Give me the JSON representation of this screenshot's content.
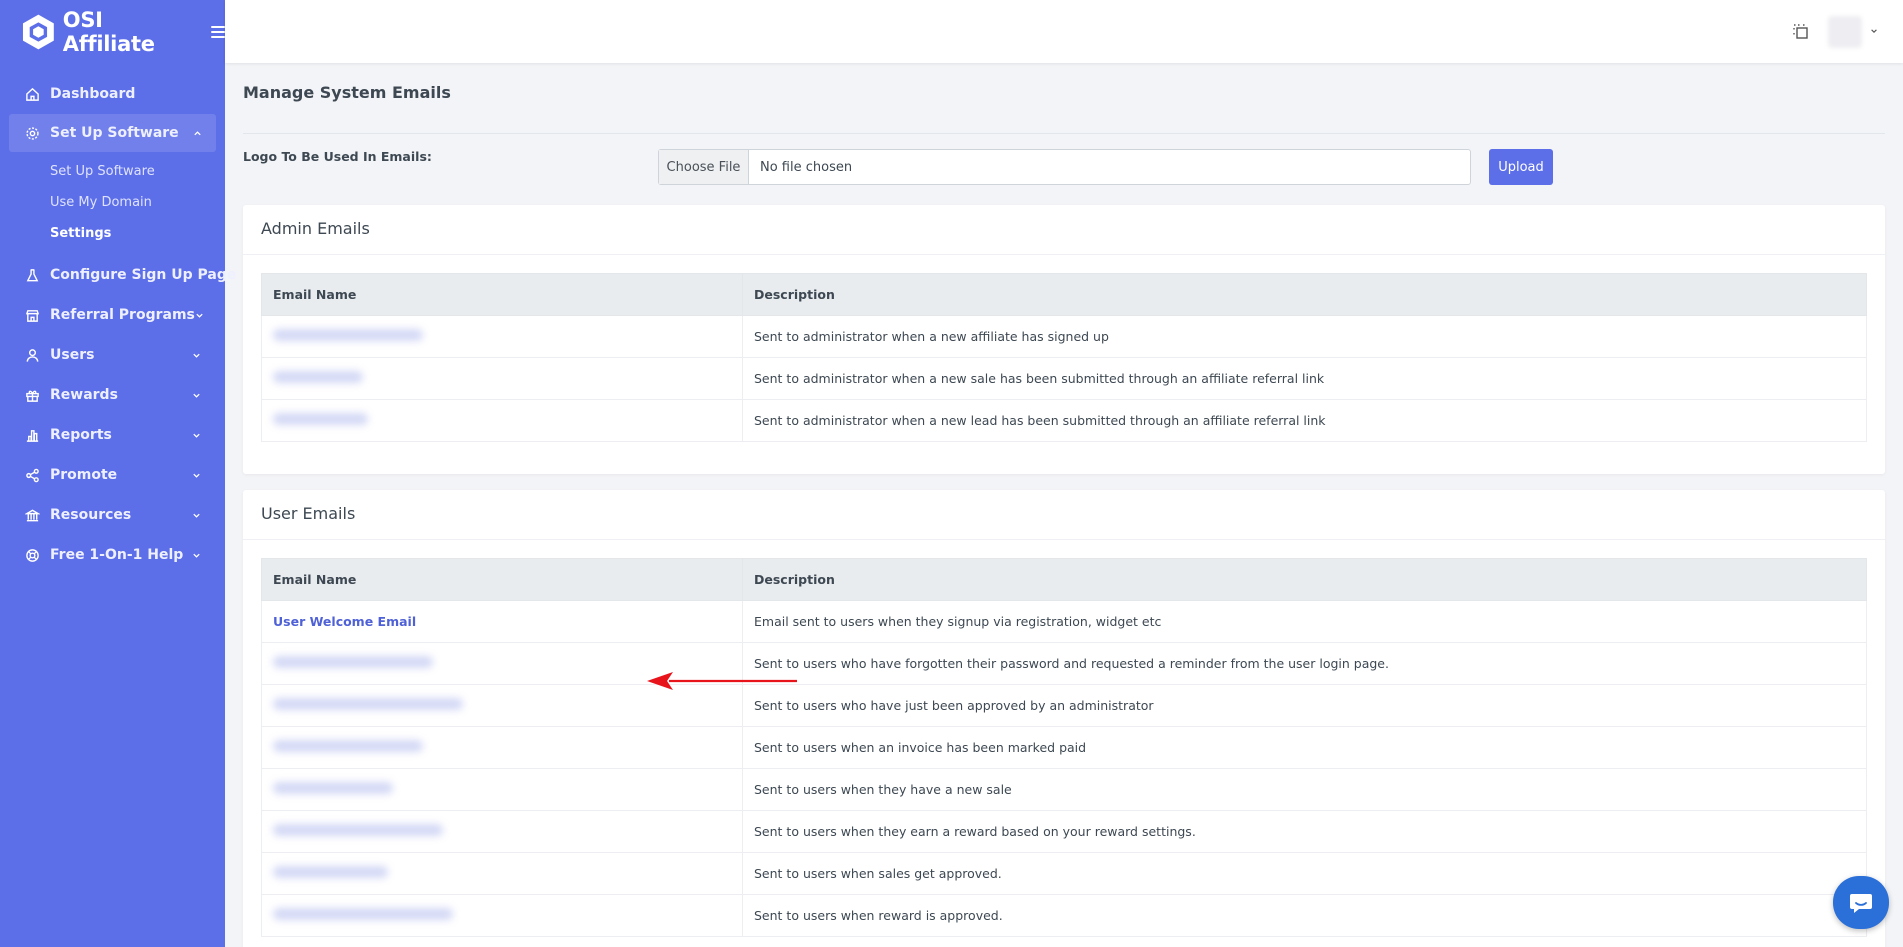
{
  "brand": {
    "name": "OSI Affiliate"
  },
  "nav": {
    "items": [
      {
        "label": "Dashboard",
        "icon": "home-icon",
        "expandable": false
      },
      {
        "label": "Set Up Software",
        "icon": "gear-icon",
        "expandable": true,
        "expanded": true,
        "children": [
          "Set Up Software",
          "Use My Domain",
          "Settings"
        ]
      },
      {
        "label": "Configure Sign Up Page",
        "icon": "flask-icon",
        "expandable": false
      },
      {
        "label": "Referral Programs",
        "icon": "store-icon",
        "expandable": true
      },
      {
        "label": "Users",
        "icon": "user-icon",
        "expandable": true
      },
      {
        "label": "Rewards",
        "icon": "gift-icon",
        "expandable": true
      },
      {
        "label": "Reports",
        "icon": "bar-chart-icon",
        "expandable": true
      },
      {
        "label": "Promote",
        "icon": "share-icon",
        "expandable": true
      },
      {
        "label": "Resources",
        "icon": "bank-icon",
        "expandable": true
      },
      {
        "label": "Free 1-On-1 Help",
        "icon": "lifebuoy-icon",
        "expandable": true
      }
    ],
    "current_sub": "Settings"
  },
  "page": {
    "title": "Manage System Emails",
    "logo_label": "Logo To Be Used In Emails:",
    "choose_file": "Choose File",
    "no_file": "No file chosen",
    "upload": "Upload"
  },
  "admin_emails": {
    "title": "Admin Emails",
    "col_name": "Email Name",
    "col_desc": "Description",
    "rows": [
      {
        "description": "Sent to administrator when a new affiliate has signed up"
      },
      {
        "description": "Sent to administrator when a new sale has been submitted through an affiliate referral link"
      },
      {
        "description": "Sent to administrator when a new lead has been submitted through an affiliate referral link"
      }
    ]
  },
  "user_emails": {
    "title": "User Emails",
    "col_name": "Email Name",
    "col_desc": "Description",
    "rows": [
      {
        "name": "User Welcome Email",
        "description": "Email sent to users when they signup via registration, widget etc"
      },
      {
        "description": "Sent to users who have forgotten their password and requested a reminder from the user login page."
      },
      {
        "description": "Sent to users who have just been approved by an administrator"
      },
      {
        "description": "Sent to users when an invoice has been marked paid"
      },
      {
        "description": "Sent to users when they have a new sale"
      },
      {
        "description": "Sent to users when they earn a reward based on your reward settings."
      },
      {
        "description": "Sent to users when sales get approved."
      },
      {
        "description": "Sent to users when reward is approved."
      }
    ]
  },
  "colors": {
    "sidebar": "#5c6ee8",
    "accent": "#5c6ee8",
    "link": "#4f61d6",
    "annotation_arrow": "#e8141b",
    "chat": "#2b6fd8"
  }
}
